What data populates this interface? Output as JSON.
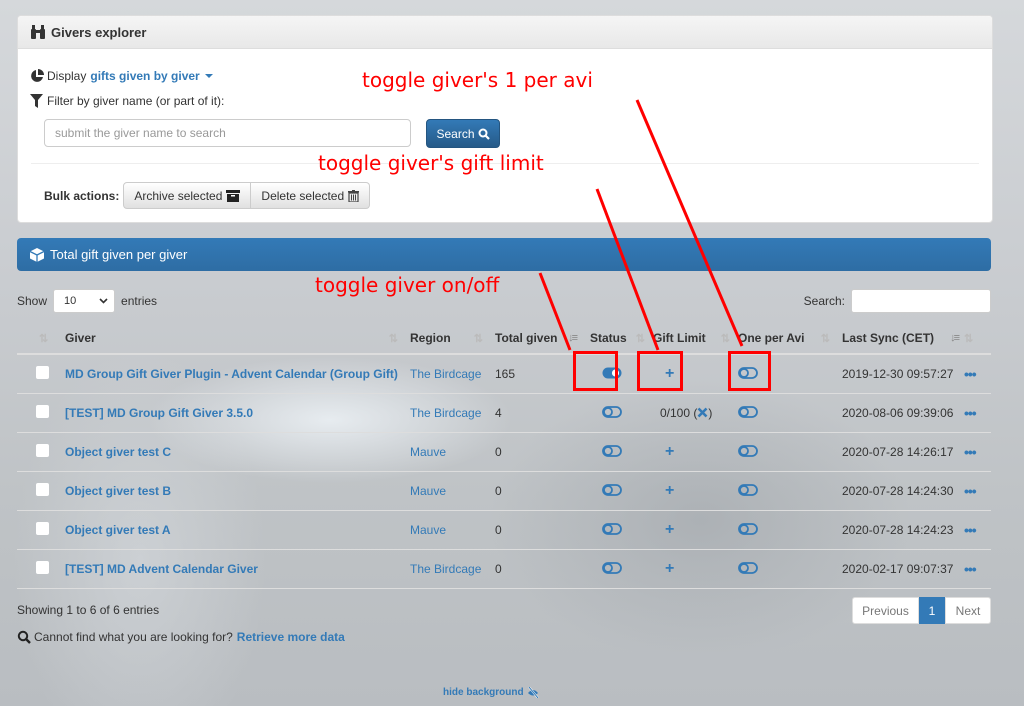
{
  "explorer": {
    "title": "Givers explorer",
    "display_prefix": "Display",
    "display_option": "gifts given by giver",
    "filter_label": "Filter by giver name (or part of it):",
    "search_placeholder": "submit the giver name to search",
    "search_button": "Search",
    "bulk_label": "Bulk actions:",
    "archive_button": "Archive selected",
    "delete_button": "Delete selected"
  },
  "table_panel": {
    "title": "Total gift given per giver",
    "show_label": "Show",
    "page_length": "10",
    "entries_label": "entries",
    "search_label": "Search:",
    "search_value": ""
  },
  "columns": [
    "Giver",
    "Region",
    "Total given",
    "Status",
    "Gift Limit",
    "One per Avi",
    "Last Sync (CET)"
  ],
  "rows": [
    {
      "giver": "MD Group Gift Giver Plugin - Advent Calendar (Group Gift)",
      "region": "The Birdcage",
      "total": "165",
      "status": "on",
      "gift_limit": "+",
      "one_per_avi": "off",
      "last_sync": "2019-12-30 09:57:27"
    },
    {
      "giver": "[TEST] MD Group Gift Giver 3.5.0",
      "region": "The Birdcage",
      "total": "4",
      "status": "off",
      "gift_limit": "0/100",
      "one_per_avi": "off",
      "last_sync": "2020-08-06 09:39:06"
    },
    {
      "giver": "Object giver test C",
      "region": "Mauve",
      "total": "0",
      "status": "off",
      "gift_limit": "+",
      "one_per_avi": "off",
      "last_sync": "2020-07-28 14:26:17"
    },
    {
      "giver": "Object giver test B",
      "region": "Mauve",
      "total": "0",
      "status": "off",
      "gift_limit": "+",
      "one_per_avi": "off",
      "last_sync": "2020-07-28 14:24:30"
    },
    {
      "giver": "Object giver test A",
      "region": "Mauve",
      "total": "0",
      "status": "off",
      "gift_limit": "+",
      "one_per_avi": "off",
      "last_sync": "2020-07-28 14:24:23"
    },
    {
      "giver": "[TEST] MD Advent Calendar Giver",
      "region": "The Birdcage",
      "total": "0",
      "status": "off",
      "gift_limit": "+",
      "one_per_avi": "off",
      "last_sync": "2020-02-17 09:07:37"
    }
  ],
  "footer": {
    "info": "Showing 1 to 6 of 6 entries",
    "more_text": "Cannot find what you are looking for?",
    "more_link": "Retrieve more data",
    "prev": "Previous",
    "current_page": "1",
    "next": "Next",
    "hide_background": "hide background"
  },
  "annotations": {
    "one_per_avi": "toggle giver's 1 per avi",
    "gift_limit": "toggle giver's gift limit",
    "status": "toggle giver on/off"
  },
  "colors": {
    "accent": "#337ab7",
    "annotation": "#ff0000"
  }
}
